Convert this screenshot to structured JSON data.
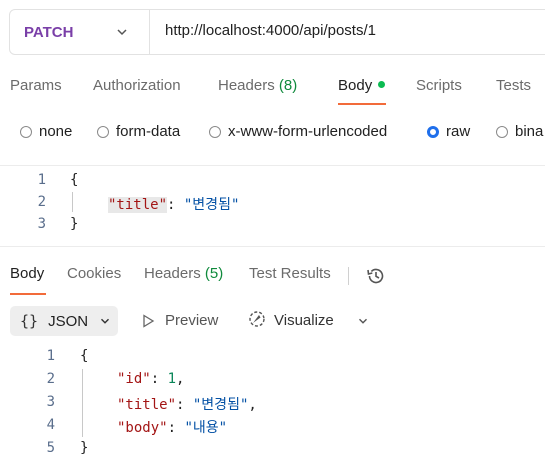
{
  "request": {
    "method": "PATCH",
    "url": "http://localhost:4000/api/posts/1"
  },
  "request_tabs": [
    {
      "label": "Params",
      "count": ""
    },
    {
      "label": "Authorization",
      "count": ""
    },
    {
      "label": "Headers",
      "count": "(8)"
    },
    {
      "label": "Body",
      "count": ""
    },
    {
      "label": "Scripts",
      "count": ""
    },
    {
      "label": "Tests",
      "count": ""
    }
  ],
  "body_types": [
    {
      "label": "none",
      "selected": false
    },
    {
      "label": "form-data",
      "selected": false
    },
    {
      "label": "x-www-form-urlencoded",
      "selected": false
    },
    {
      "label": "raw",
      "selected": true
    },
    {
      "label": "bina",
      "selected": false
    }
  ],
  "request_body": {
    "line_numbers": [
      "1",
      "2",
      "3"
    ],
    "open_brace": "{",
    "close_brace": "}",
    "key": "\"title\"",
    "colon": ": ",
    "value": "\"변경됨\""
  },
  "response_tabs": [
    {
      "label": "Body",
      "count": ""
    },
    {
      "label": "Cookies",
      "count": ""
    },
    {
      "label": "Headers",
      "count": "(5)"
    },
    {
      "label": "Test Results",
      "count": ""
    }
  ],
  "response_toolbar": {
    "format": "JSON",
    "preview": "Preview",
    "visualize": "Visualize"
  },
  "response_body": {
    "line_numbers": [
      "1",
      "2",
      "3",
      "4",
      "5"
    ],
    "open_brace": "{",
    "close_brace": "}",
    "id_key": "\"id\"",
    "id_value": "1",
    "title_key": "\"title\"",
    "title_value": "\"변경됨\"",
    "body_key": "\"body\"",
    "body_value": "\"내용\"",
    "comma": ","
  },
  "colors": {
    "method": "#7a3fa8",
    "active_tab_underline": "#f26b3a",
    "body_dot": "#0cbb52",
    "count": "#0f8a3c",
    "radio_selected": "#1f6feb"
  }
}
